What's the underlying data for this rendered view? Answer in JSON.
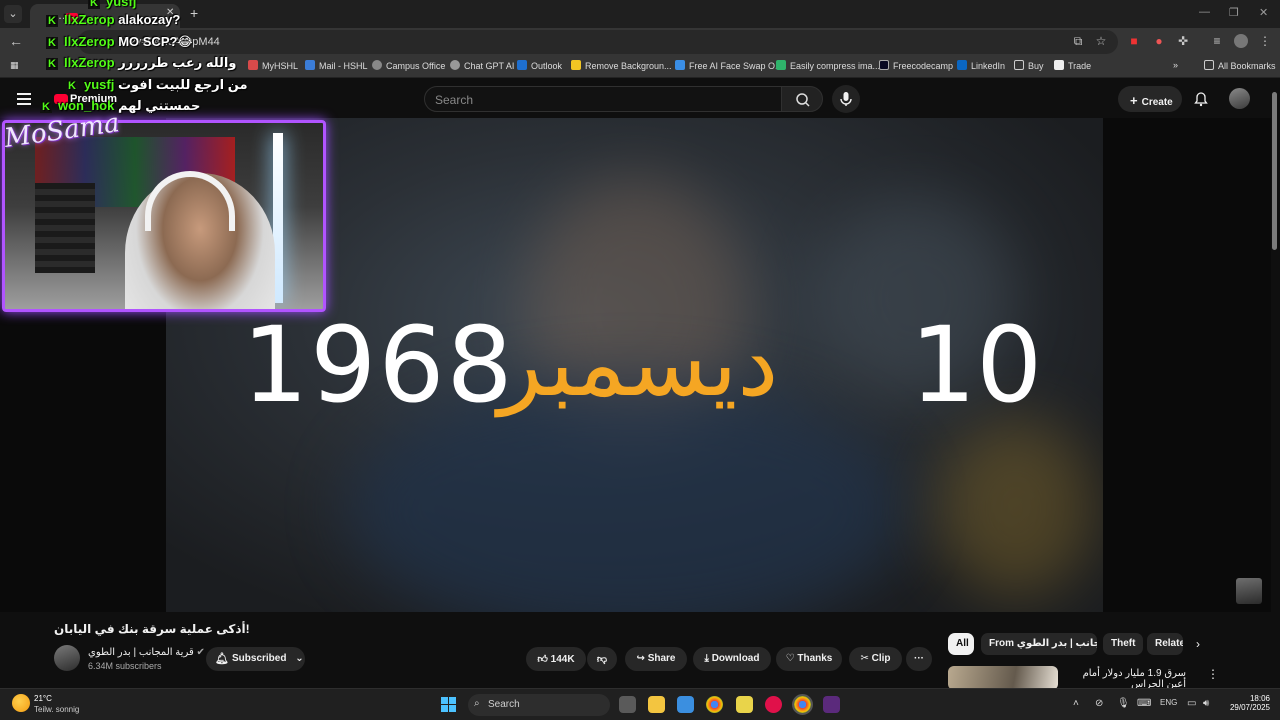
{
  "browser": {
    "tab_title": "…",
    "url": "ch?v=04HcArDpM44",
    "bookmarks": [
      "MyHSHL",
      "Mail - HSHL",
      "Campus Office",
      "Chat GPT AI",
      "Outlook",
      "Remove Backgroun...",
      "Free AI Face Swap O...",
      "Easily compress ima...",
      "Freecodecamp",
      "LinkedIn",
      "Buy",
      "Trade"
    ],
    "all_bookmarks": "All Bookmarks"
  },
  "youtube": {
    "search_placeholder": "Search",
    "premium_label": "Premium",
    "create_label": "Create",
    "video_overlay": {
      "year": "1968",
      "month": "ديسمبر",
      "day": "10"
    },
    "video_title": "!أذكى عملية سرقة بنك في اليابان",
    "channel_name": "قرية المجانب | بدر الطوي",
    "subscribers": "6.34M subscribers",
    "subscribed_label": "Subscribed",
    "likes": "144K",
    "share_label": "Share",
    "download_label": "Download",
    "thanks_label": "Thanks",
    "clip_label": "Clip",
    "more_label": "···",
    "chips": [
      "All",
      "From قرية المجانب | بدر الطوي",
      "Theft",
      "Relate"
    ],
    "recommended_title": "سرق 1.9 مليار دولار أمام أعين الحراس"
  },
  "stream": {
    "streamer_name": "MoSama",
    "chat": [
      {
        "user": "yusfj",
        "text": ""
      },
      {
        "user": "IlxZerop",
        "text": "alakozay?"
      },
      {
        "user": "IlxZerop",
        "text": "MO SCP?😂"
      },
      {
        "user": "IlxZerop",
        "text": "والله رعب طررررر"
      },
      {
        "user": "yusfj",
        "text": "من ارجع للبيت افوت"
      },
      {
        "user": "won_hok",
        "text": "حمستني لهم"
      }
    ],
    "badge": "K"
  },
  "taskbar": {
    "temperature": "21°C",
    "weather": "Teilw. sonnig",
    "search_label": "Search",
    "language": "ENG",
    "time": "18:06",
    "date": "29/07/2025"
  },
  "colors": {
    "accent_orange": "#f5a623",
    "kick_green": "#53fc18",
    "yt_red": "#ff0033",
    "cam_border": "#b154ff"
  }
}
